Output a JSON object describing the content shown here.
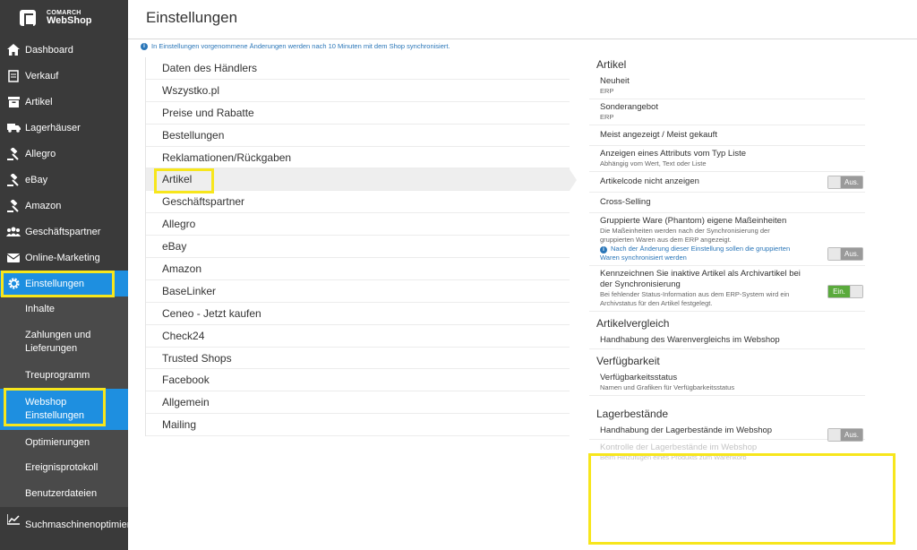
{
  "brand": {
    "line1": "COMARCH",
    "line2": "WebShop"
  },
  "header": {
    "title": "Einstellungen"
  },
  "info": "In Einstellungen vorgenommene Änderungen werden nach 10 Minuten mit dem Shop synchronisiert.",
  "sidebar": {
    "items": [
      {
        "label": "Dashboard",
        "icon": "home-icon"
      },
      {
        "label": "Verkauf",
        "icon": "document-icon"
      },
      {
        "label": "Artikel",
        "icon": "box-icon"
      },
      {
        "label": "Lagerhäuser",
        "icon": "truck-icon"
      },
      {
        "label": "Allegro",
        "icon": "gavel-icon"
      },
      {
        "label": "eBay",
        "icon": "gavel-icon"
      },
      {
        "label": "Amazon",
        "icon": "gavel-icon"
      },
      {
        "label": "Geschäftspartner",
        "icon": "users-icon"
      },
      {
        "label": "Online-Marketing",
        "icon": "mail-icon"
      },
      {
        "label": "Einstellungen",
        "icon": "gear-icon"
      }
    ],
    "sub_items": [
      {
        "label": "Inhalte"
      },
      {
        "label": "Zahlungen und Lieferungen"
      },
      {
        "label": "Treuprogramm"
      },
      {
        "label": "Webshop Einstellungen"
      },
      {
        "label": "Optimierungen"
      },
      {
        "label": "Ereignisprotokoll"
      },
      {
        "label": "Benutzerdateien"
      }
    ],
    "bottom": {
      "label": "Suchmaschinenoptimierung",
      "icon": "chart-line-icon"
    }
  },
  "menu": [
    "Daten des Händlers",
    "Wszystko.pl",
    "Preise und Rabatte",
    "Bestellungen",
    "Reklamationen/Rückgaben",
    "Artikel",
    "Geschäftspartner",
    "Allegro",
    "eBay",
    "Amazon",
    "BaseLinker",
    "Ceneo - Jetzt kaufen",
    "Check24",
    "Trusted Shops",
    "Facebook",
    "Allgemein",
    "Mailing"
  ],
  "panel": {
    "artikel_title": "Artikel",
    "rows": {
      "neuheit": {
        "title": "Neuheit",
        "sub": "ERP"
      },
      "sonderangebot": {
        "title": "Sonderangebot",
        "sub": "ERP"
      },
      "meist": {
        "title": "Meist angezeigt / Meist gekauft"
      },
      "attribut": {
        "title": "Anzeigen eines Attributs vom Typ Liste",
        "sub": "Abhängig vom Wert, Text oder Liste"
      },
      "artikelcode": {
        "title": "Artikelcode nicht anzeigen",
        "toggle": "Aus."
      },
      "crossselling": {
        "title": "Cross-Selling"
      },
      "gruppierte": {
        "title": "Gruppierte Ware (Phantom) eigene Maßeinheiten",
        "sub": "Die Maßeinheiten werden nach der Synchronisierung der gruppierten Waren aus dem ERP angezeigt.",
        "note": "Nach der Änderung dieser Einstellung sollen die gruppierten Waren synchronisiert werden",
        "toggle": "Aus."
      },
      "kennzeichnen": {
        "title": "Kennzeichnen Sie inaktive Artikel als Archivartikel bei der Synchronisierung",
        "sub": "Bei fehlender Status-Information aus dem ERP-System wird ein Archivstatus für den Artikel festgelegt.",
        "toggle": "Ein."
      }
    },
    "vergleich_title": "Artikelvergleich",
    "vergleich_row": {
      "title": "Handhabung des Warenvergleichs im Webshop"
    },
    "verf_title": "Verfügbarkeit",
    "verf_row": {
      "title": "Verfügbarkeitsstatus",
      "sub": "Namen und Grafiken für Verfügbarkeitsstatus"
    },
    "lager_title": "Lagerbestände",
    "lager_row1": {
      "title": "Handhabung der Lagerbestände im Webshop",
      "toggle": "Aus."
    },
    "lager_row2": {
      "title": "Kontrolle der Lagerbestände im Webshop",
      "sub": "Beim Hinzufügen eines Produkts zum Warenkorb"
    }
  },
  "colors": {
    "sidebar": "#3a3a3a",
    "active": "#1e8fe0",
    "highlight": "#f7e61c",
    "link": "#2a76b8",
    "toggle_on": "#5aaa3c"
  }
}
